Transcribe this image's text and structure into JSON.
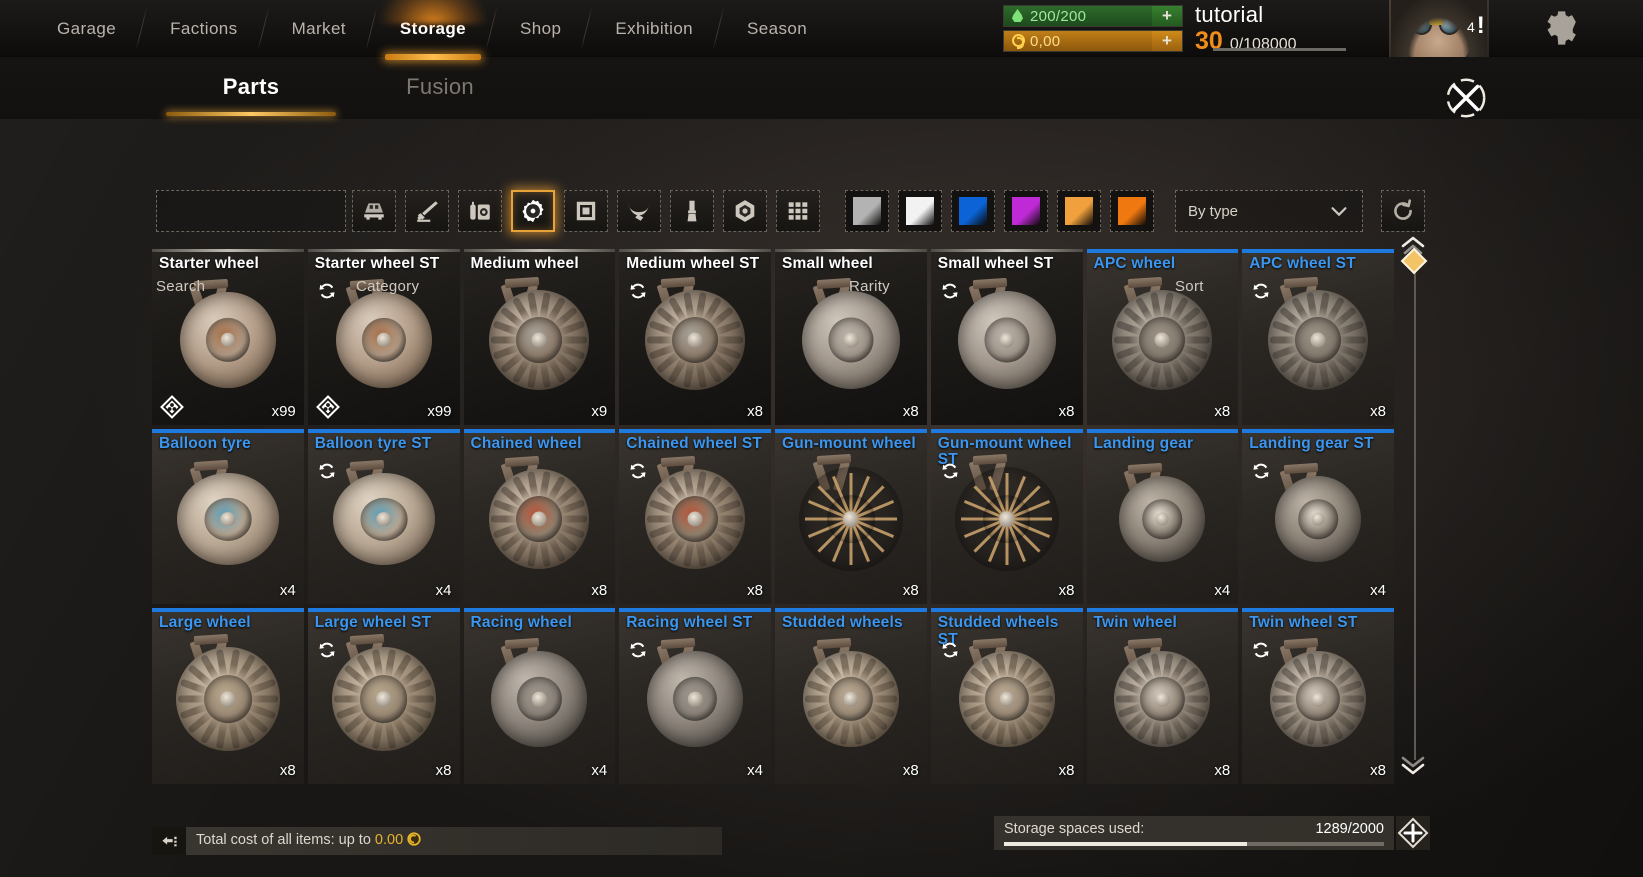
{
  "topnav": {
    "items": [
      {
        "label": "Garage",
        "active": false
      },
      {
        "label": "Factions",
        "active": false
      },
      {
        "label": "Market",
        "active": false
      },
      {
        "label": "Storage",
        "active": true
      },
      {
        "label": "Shop",
        "active": false
      },
      {
        "label": "Exhibition",
        "active": false
      },
      {
        "label": "Season",
        "active": false
      }
    ]
  },
  "player": {
    "fuel": "200/200",
    "coins": "0,00",
    "name": "tutorial",
    "level": "30",
    "xp": "0/108000",
    "alert_count": "4",
    "fuel_color": "#2e6b2c",
    "coin_color": "#c07f18",
    "level_color": "#f08c18"
  },
  "subtabs": {
    "items": [
      {
        "label": "Parts",
        "active": true
      },
      {
        "label": "Fusion",
        "active": false
      }
    ]
  },
  "filters": {
    "search_label": "Search",
    "search_value": "",
    "search_placeholder": "",
    "category_label": "Category",
    "rarity_label": "Rarity",
    "sort_label": "Sort",
    "sort_value": "By type",
    "categories": [
      {
        "name": "cabin-icon",
        "selected": false
      },
      {
        "name": "weapon-icon",
        "selected": false
      },
      {
        "name": "module-icon",
        "selected": false
      },
      {
        "name": "wheel-icon",
        "selected": true
      },
      {
        "name": "structure-icon",
        "selected": false
      },
      {
        "name": "decor-icon",
        "selected": false
      },
      {
        "name": "paint-icon",
        "selected": false
      },
      {
        "name": "hardware-icon",
        "selected": false
      },
      {
        "name": "all-items-icon",
        "selected": false
      }
    ],
    "rarities": [
      {
        "name": "common-rarity",
        "color": "#b3b3b3"
      },
      {
        "name": "standard-rarity",
        "color": "#f2f2f2"
      },
      {
        "name": "rare-rarity",
        "color": "#0b63d6"
      },
      {
        "name": "epic-rarity",
        "color": "#c02ad6"
      },
      {
        "name": "legendary-rarity",
        "color": "#f0a03c"
      },
      {
        "name": "relic-rarity",
        "color": "#f07810"
      }
    ]
  },
  "grid": {
    "items": [
      {
        "name": "Starter wheel",
        "qty": "x99",
        "rarity": "common",
        "stackable": false,
        "badge": true,
        "art": "balloon"
      },
      {
        "name": "Starter wheel ST",
        "qty": "x99",
        "rarity": "common",
        "stackable": true,
        "badge": true,
        "art": "balloon"
      },
      {
        "name": "Medium wheel",
        "qty": "x9",
        "rarity": "common",
        "stackable": false,
        "badge": false,
        "art": "knobby"
      },
      {
        "name": "Medium wheel ST",
        "qty": "x8",
        "rarity": "common",
        "stackable": true,
        "badge": false,
        "art": "knobby"
      },
      {
        "name": "Small wheel",
        "qty": "x8",
        "rarity": "common",
        "stackable": false,
        "badge": false,
        "art": "small"
      },
      {
        "name": "Small wheel ST",
        "qty": "x8",
        "rarity": "common",
        "stackable": true,
        "badge": false,
        "art": "small"
      },
      {
        "name": "APC wheel",
        "qty": "x8",
        "rarity": "rare",
        "stackable": false,
        "badge": false,
        "art": "apc"
      },
      {
        "name": "APC wheel ST",
        "qty": "x8",
        "rarity": "rare",
        "stackable": true,
        "badge": false,
        "art": "apc"
      },
      {
        "name": "Balloon tyre",
        "qty": "x4",
        "rarity": "rare",
        "stackable": false,
        "badge": false,
        "art": "balloon2"
      },
      {
        "name": "Balloon tyre ST",
        "qty": "x4",
        "rarity": "rare",
        "stackable": true,
        "badge": false,
        "art": "balloon2"
      },
      {
        "name": "Chained wheel",
        "qty": "x8",
        "rarity": "rare",
        "stackable": false,
        "badge": false,
        "art": "chained"
      },
      {
        "name": "Chained wheel ST",
        "qty": "x8",
        "rarity": "rare",
        "stackable": true,
        "badge": false,
        "art": "chained"
      },
      {
        "name": "Gun-mount wheel",
        "qty": "x8",
        "rarity": "rare",
        "stackable": false,
        "badge": false,
        "art": "spoked"
      },
      {
        "name": "Gun-mount wheel ST",
        "qty": "x8",
        "rarity": "rare",
        "stackable": true,
        "badge": false,
        "art": "spoked"
      },
      {
        "name": "Landing gear",
        "qty": "x4",
        "rarity": "rare",
        "stackable": false,
        "badge": false,
        "art": "landing"
      },
      {
        "name": "Landing gear ST",
        "qty": "x4",
        "rarity": "rare",
        "stackable": true,
        "badge": false,
        "art": "landing"
      },
      {
        "name": "Large wheel",
        "qty": "x8",
        "rarity": "rare",
        "stackable": false,
        "badge": false,
        "art": "large"
      },
      {
        "name": "Large wheel ST",
        "qty": "x8",
        "rarity": "rare",
        "stackable": true,
        "badge": false,
        "art": "large"
      },
      {
        "name": "Racing wheel",
        "qty": "x4",
        "rarity": "rare",
        "stackable": false,
        "badge": false,
        "art": "racing"
      },
      {
        "name": "Racing wheel ST",
        "qty": "x4",
        "rarity": "rare",
        "stackable": true,
        "badge": false,
        "art": "racing"
      },
      {
        "name": "Studded wheels",
        "qty": "x8",
        "rarity": "rare",
        "stackable": false,
        "badge": false,
        "art": "studded"
      },
      {
        "name": "Studded wheels ST",
        "qty": "x8",
        "rarity": "rare",
        "stackable": true,
        "badge": false,
        "art": "studded"
      },
      {
        "name": "Twin wheel",
        "qty": "x8",
        "rarity": "rare",
        "stackable": false,
        "badge": false,
        "art": "twin"
      },
      {
        "name": "Twin wheel ST",
        "qty": "x8",
        "rarity": "rare",
        "stackable": true,
        "badge": false,
        "art": "twin"
      }
    ]
  },
  "footer": {
    "cost_text": "Total cost of all items: up to",
    "cost_amount": "0.00",
    "storage_label": "Storage spaces used:",
    "storage_value": "1289/2000",
    "storage_percent": 64
  }
}
